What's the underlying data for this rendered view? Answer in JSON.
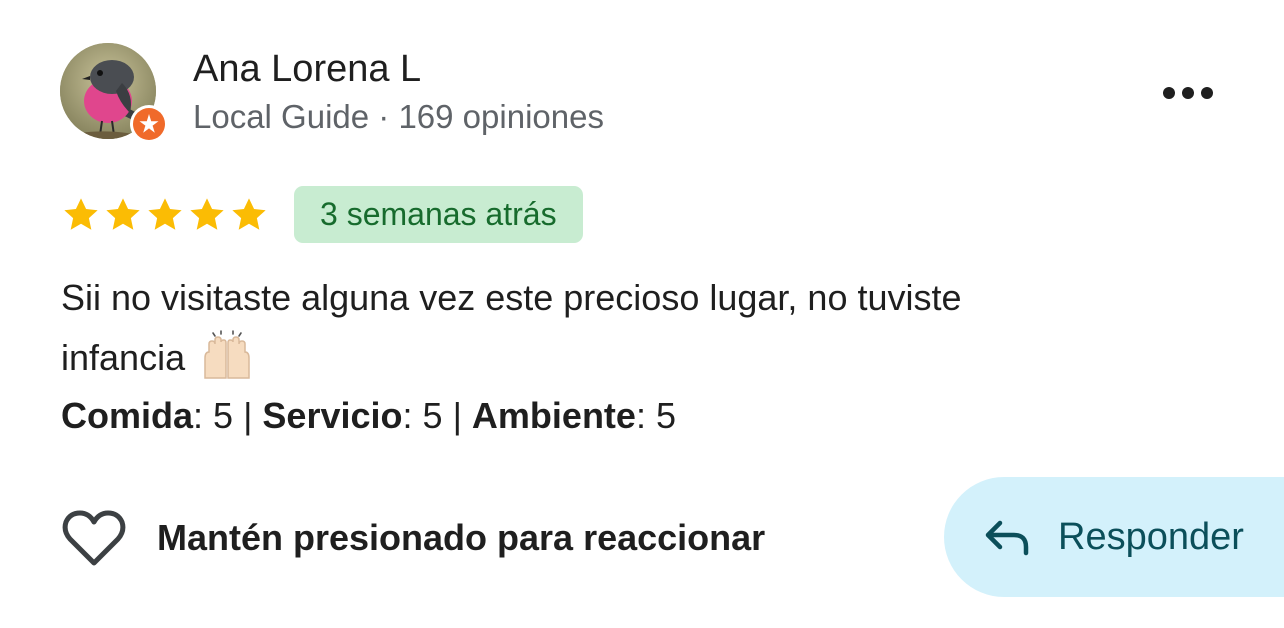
{
  "author": {
    "name": "Ana Lorena L",
    "badge_title": "Local Guide",
    "separator": " · ",
    "reviews_count": "169 opiniones",
    "avatar_icon": "bird-avatar-image",
    "badge_icon": "local-guide-star-icon",
    "badge_color": "#f06a2a"
  },
  "menu": {
    "icon": "more-horizontal-icon"
  },
  "review": {
    "rating": 5,
    "rating_max": 5,
    "star_color": "#fbbc04",
    "time_ago": "3 semanas atrás",
    "text_line1": "Sii no visitaste alguna vez este precioso lugar, no tuviste",
    "text_line2": "infancia",
    "emoji_icon": "raising-hands-emoji",
    "subratings": [
      {
        "label": "Comida",
        "value": "5"
      },
      {
        "label": "Servicio",
        "value": "5"
      },
      {
        "label": "Ambiente",
        "value": "5"
      }
    ]
  },
  "actions": {
    "react_label": "Mantén presionado para reaccionar",
    "react_icon": "heart-outline-icon",
    "reply_label": "Responder",
    "reply_icon": "reply-arrow-icon",
    "reply_bg_color": "#d3f1fb"
  }
}
